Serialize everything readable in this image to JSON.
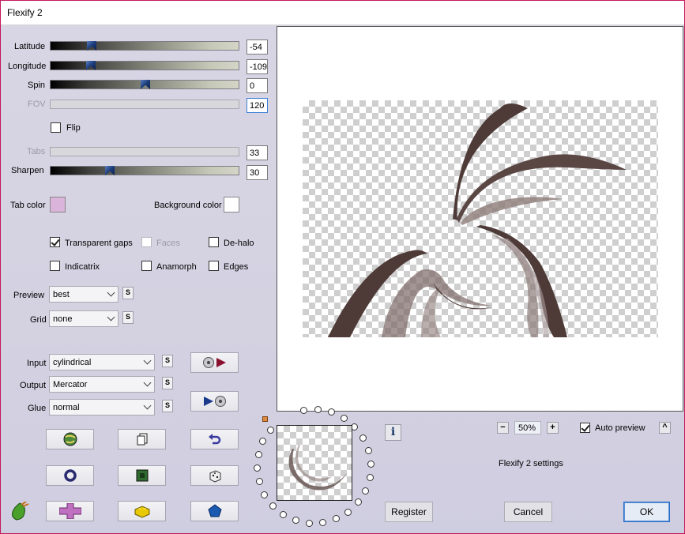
{
  "window": {
    "title": "Flexify 2"
  },
  "sliders": {
    "latitude": {
      "label": "Latitude",
      "value": "-54"
    },
    "longitude": {
      "label": "Longitude",
      "value": "-109"
    },
    "spin": {
      "label": "Spin",
      "value": "0"
    },
    "fov": {
      "label": "FOV",
      "value": "120"
    },
    "tabs": {
      "label": "Tabs",
      "value": "33"
    },
    "sharpen": {
      "label": "Sharpen",
      "value": "30"
    }
  },
  "flip": {
    "label": "Flip"
  },
  "colors": {
    "tab_color_label": "Tab color",
    "tab_color": "#dbb4dc",
    "background_color_label": "Background color",
    "background_color": "#ffffff"
  },
  "options": {
    "transparent_gaps": "Transparent gaps",
    "faces": "Faces",
    "de_halo": "De-halo",
    "indicatrix": "Indicatrix",
    "anamorph": "Anamorph",
    "edges": "Edges"
  },
  "preview_select": {
    "label": "Preview",
    "value": "best"
  },
  "grid_select": {
    "label": "Grid",
    "value": "none"
  },
  "input_select": {
    "label": "Input",
    "value": "cylindrical"
  },
  "output_select": {
    "label": "Output",
    "value": "Mercator"
  },
  "glue_select": {
    "label": "Glue",
    "value": "normal"
  },
  "s_button": "S",
  "zoom": {
    "level": "50%",
    "minus": "−",
    "plus": "+"
  },
  "auto_preview": {
    "label": "Auto preview",
    "collapse": "^"
  },
  "settings_label": "Flexify 2 settings",
  "info_button": "i",
  "buttons": {
    "register": "Register",
    "cancel": "Cancel",
    "ok": "OK"
  },
  "accent": {
    "shape_color": "#4e3b38",
    "thumb_color": "#1c3c7a"
  }
}
